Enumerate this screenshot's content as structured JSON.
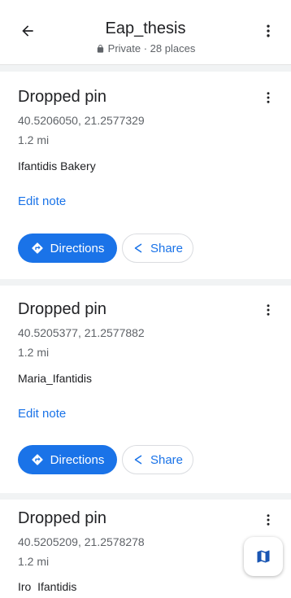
{
  "header": {
    "title": "Eap_thesis",
    "subtitle": "Private · 28 places"
  },
  "places": [
    {
      "title": "Dropped pin",
      "coords": "40.5206050, 21.2577329",
      "distance": "1.2 mi",
      "note": "Ifantidis Bakery",
      "edit_label": "Edit note",
      "directions_label": "Directions",
      "share_label": "Share"
    },
    {
      "title": "Dropped pin",
      "coords": "40.5205377, 21.2577882",
      "distance": "1.2 mi",
      "note": "Maria_Ifantidis",
      "edit_label": "Edit note",
      "directions_label": "Directions",
      "share_label": "Share"
    },
    {
      "title": "Dropped pin",
      "coords": "40.5205209, 21.2578278",
      "distance": "1.2 mi",
      "note": "Iro  Ifantidis"
    }
  ],
  "colors": {
    "accent": "#1a73e8",
    "text_primary": "#202124",
    "text_secondary": "#5f6368"
  },
  "icons": {
    "back": "arrow-left-icon",
    "more": "more-vert-icon",
    "lock": "lock-icon",
    "directions": "directions-icon",
    "share": "share-icon",
    "map": "map-icon"
  }
}
